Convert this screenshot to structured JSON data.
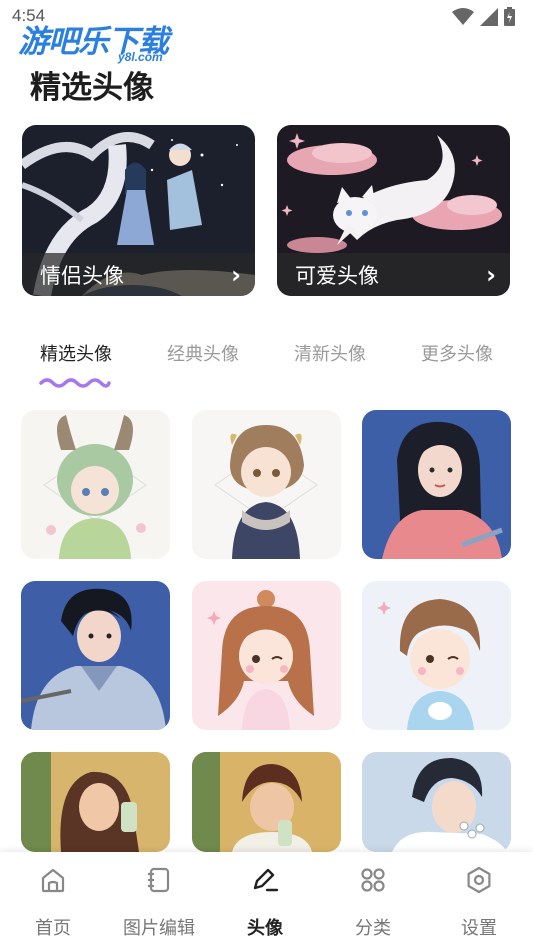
{
  "status_bar": {
    "time": "4:54"
  },
  "watermark": {
    "main": "游吧乐下载",
    "sub": "y8l.com"
  },
  "page_title": "精选头像",
  "banners": [
    {
      "label": "情侣头像",
      "arrow": "›"
    },
    {
      "label": "可爱头像",
      "arrow": "›"
    }
  ],
  "tabs": [
    {
      "label": "精选头像",
      "active": true
    },
    {
      "label": "经典头像",
      "active": false
    },
    {
      "label": "清新头像",
      "active": false
    },
    {
      "label": "更多头像",
      "active": false
    }
  ],
  "avatars": [
    {
      "name": "dragon-girl-avatar"
    },
    {
      "name": "puppy-boy-avatar"
    },
    {
      "name": "long-hair-girl-avatar"
    },
    {
      "name": "cyclist-boy-avatar"
    },
    {
      "name": "cute-girl-avatar"
    },
    {
      "name": "cute-boy-avatar"
    },
    {
      "name": "sunset-girl-avatar"
    },
    {
      "name": "sunset-boy-avatar"
    },
    {
      "name": "flower-boy-avatar"
    }
  ],
  "bottom_nav": [
    {
      "label": "首页",
      "icon": "home-icon",
      "active": false
    },
    {
      "label": "图片编辑",
      "icon": "image-edit-icon",
      "active": false
    },
    {
      "label": "头像",
      "icon": "pen-icon",
      "active": true
    },
    {
      "label": "分类",
      "icon": "category-icon",
      "active": false
    },
    {
      "label": "设置",
      "icon": "settings-icon",
      "active": false
    }
  ],
  "colors": {
    "accent_wave": "#a777ee",
    "watermark_blue": "#2a7fe0"
  }
}
